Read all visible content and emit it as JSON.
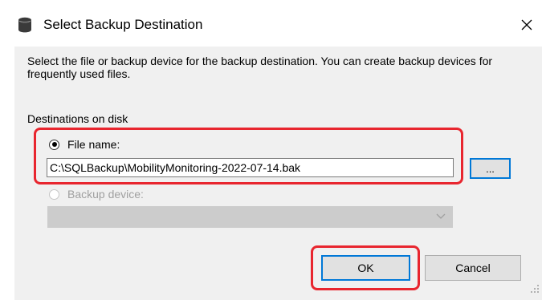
{
  "window": {
    "title": "Select Backup Destination",
    "close_glyph": "✕"
  },
  "dialog": {
    "description": "Select the file or backup device for the backup destination. You can create backup devices for frequently used files.",
    "group_label": "Destinations on disk",
    "file_name_label": "File name:",
    "file_name_checked": true,
    "file_path_value": "C:\\SQLBackup\\MobilityMonitoring-2022-07-14.bak",
    "browse_label": "...",
    "backup_device_label": "Backup device:",
    "backup_device_checked": false,
    "backup_device_value": "",
    "ok_label": "OK",
    "cancel_label": "Cancel"
  },
  "icons": {
    "title_icon": "database-icon",
    "close_icon": "close-icon",
    "dropdown_icon": "chevron-down-icon",
    "grip_icon": "resize-grip-icon"
  },
  "colors": {
    "accent": "#0078d7",
    "highlight": "#e8262f",
    "panel": "#f0f0f0",
    "disabled_text": "#a0a0a0"
  }
}
